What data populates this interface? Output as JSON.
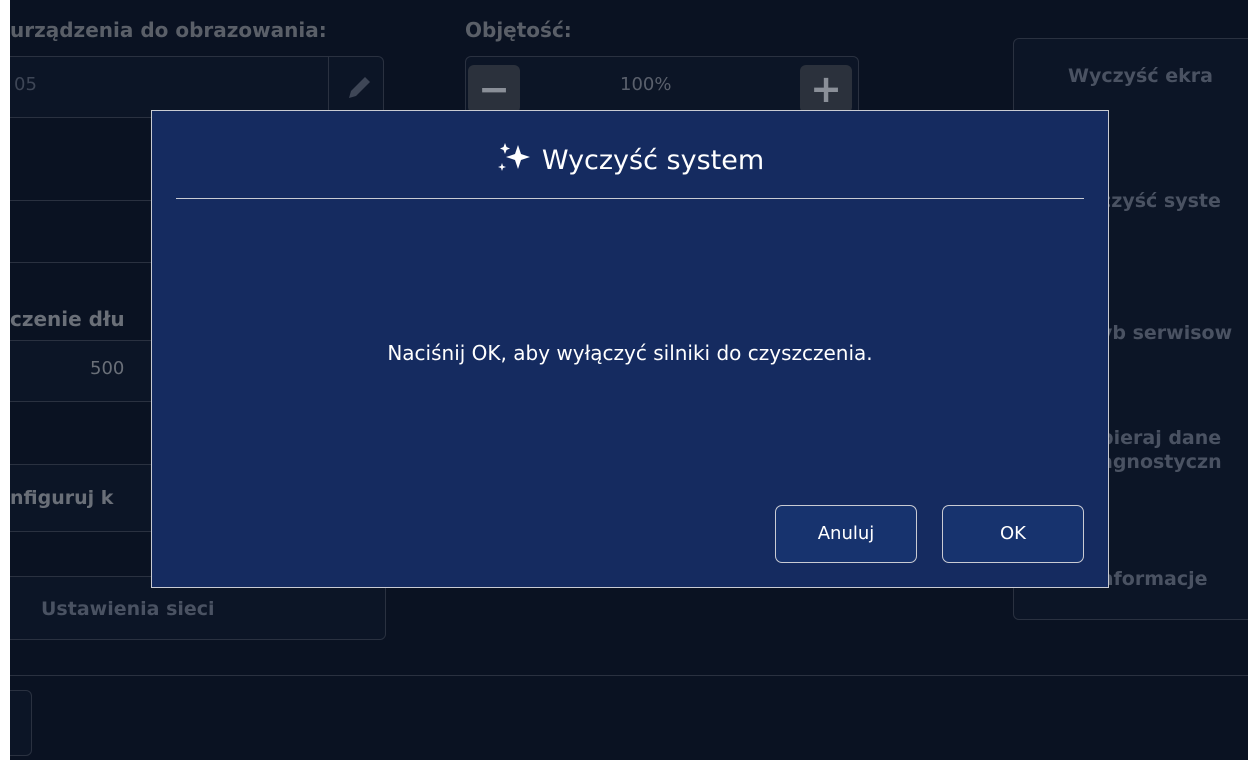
{
  "background": {
    "imaging_device_label": "urządzenia do obrazowania:",
    "imaging_device_value": "05",
    "volume_label": "Objętość:",
    "volume_value": "100%",
    "length_label": "czenie dłu",
    "length_value": "500",
    "configure_label": "nfiguruj k",
    "network_settings_label": "Ustawienia sieci",
    "right_buttons": {
      "clear_screen": "Wyczyść ekra",
      "clear_system": "czyść syste",
      "service_mode": "yb serwisow",
      "collect_data_line1": "bieraj dane",
      "collect_data_line2": "agnostyczn",
      "information": "nformacje"
    }
  },
  "dialog": {
    "title": "Wyczyść system",
    "message": "Naciśnij OK, aby wyłączyć silniki do czyszczenia.",
    "cancel_label": "Anuluj",
    "ok_label": "OK"
  },
  "colors": {
    "screen_bg": "#0a1222",
    "dialog_bg": "#152b60",
    "dialog_border": "#c9cbd3"
  },
  "icons": {
    "title_icon": "sparkle-icon",
    "pencil": "pencil-icon",
    "minus": "minus-icon",
    "plus": "plus-icon"
  }
}
